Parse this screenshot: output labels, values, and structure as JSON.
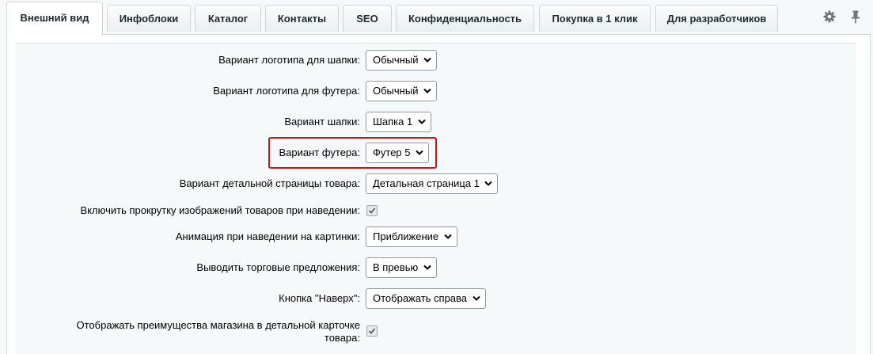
{
  "tabs": [
    {
      "label": "Внешний вид",
      "active": true
    },
    {
      "label": "Инфоблоки"
    },
    {
      "label": "Каталог"
    },
    {
      "label": "Контакты"
    },
    {
      "label": "SEO"
    },
    {
      "label": "Конфиденциальность"
    },
    {
      "label": "Покупка в 1 клик"
    },
    {
      "label": "Для разработчиков"
    }
  ],
  "toolbar_icons": [
    "gear-icon",
    "pin-icon"
  ],
  "settings": [
    {
      "label": "Вариант логотипа для шапки:",
      "value": "Обычный",
      "type": "select"
    },
    {
      "label": "Вариант логотипа для футера:",
      "value": "Обычный",
      "type": "select"
    },
    {
      "label": "Вариант шапки:",
      "value": "Шапка 1",
      "type": "select"
    },
    {
      "label": "Вариант футера:",
      "value": "Футер 5",
      "type": "select",
      "highlighted": true
    },
    {
      "label": "Вариант детальной страницы товара:",
      "value": "Детальная страница 1",
      "type": "select"
    },
    {
      "label": "Включить прокрутку изображений товаров при наведении:",
      "checked": true,
      "type": "checkbox"
    },
    {
      "label": "Анимация при наведении на картинки:",
      "value": "Приближение",
      "type": "select"
    },
    {
      "label": "Выводить торговые предложения:",
      "value": "В превью",
      "type": "select"
    },
    {
      "label": "Кнопка \"Наверх\":",
      "value": "Отображать справа",
      "type": "select"
    },
    {
      "label": "Отображать преимущества магазина в детальной карточке товара:",
      "checked": true,
      "type": "checkbox"
    }
  ],
  "colors": {
    "highlight": "#c4161c",
    "background": "#f5f9f9",
    "border": "#ced5d6"
  }
}
